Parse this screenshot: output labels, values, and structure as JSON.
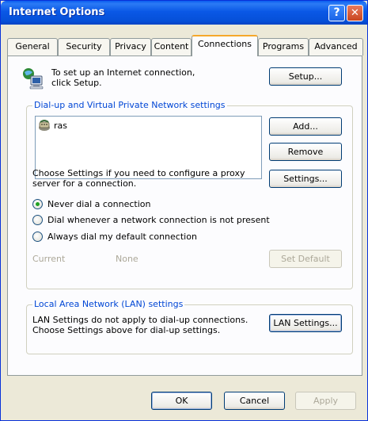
{
  "window": {
    "title": "Internet Options"
  },
  "titlebar": {
    "help_glyph": "?",
    "close_glyph": "✕"
  },
  "tabs": [
    {
      "label": "General",
      "active": false
    },
    {
      "label": "Security",
      "active": false
    },
    {
      "label": "Privacy",
      "active": false
    },
    {
      "label": "Content",
      "active": false
    },
    {
      "label": "Connections",
      "active": true
    },
    {
      "label": "Programs",
      "active": false
    },
    {
      "label": "Advanced",
      "active": false
    }
  ],
  "setup": {
    "icon": "network-computer-icon",
    "text": "To set up an Internet connection, click Setup.",
    "button": "Setup..."
  },
  "dialup": {
    "group_title": "Dial-up and Virtual Private Network settings",
    "connections": [
      {
        "icon": "dialup-connection-icon",
        "name": "ras"
      }
    ],
    "add_button": "Add...",
    "remove_button": "Remove",
    "settings_text": "Choose Settings if you need to configure a proxy server for a connection.",
    "settings_button": "Settings...",
    "options": [
      {
        "label": "Never dial a connection",
        "selected": true
      },
      {
        "label": "Dial whenever a network connection is not present",
        "selected": false
      },
      {
        "label": "Always dial my default connection",
        "selected": false
      }
    ],
    "current_label": "Current",
    "current_value": "None",
    "set_default_button": "Set Default"
  },
  "lan": {
    "group_title": "Local Area Network (LAN) settings",
    "text": "LAN Settings do not apply to dial-up connections. Choose Settings above for dial-up settings.",
    "button": "LAN Settings..."
  },
  "footer": {
    "ok": "OK",
    "cancel": "Cancel",
    "apply": "Apply"
  },
  "colors": {
    "accent": "#0046d5",
    "titlebar": "#0a58e6",
    "tab_highlight": "#f5a82c",
    "radio_dot": "#21a121"
  }
}
